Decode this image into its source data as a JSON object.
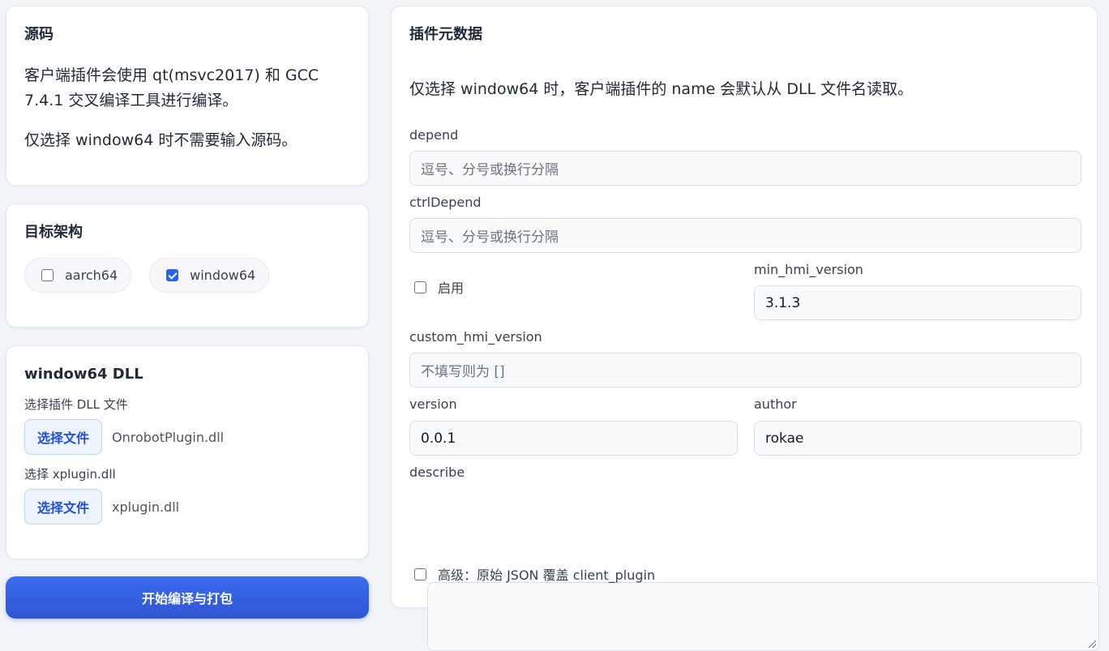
{
  "source": {
    "title": "源码",
    "line1": "客户端插件会使用 qt(msvc2017) 和 GCC 7.4.1 交叉编译工具进行编译。",
    "line2": "仅选择 window64 时不需要输入源码。"
  },
  "arch": {
    "title": "目标架构",
    "options": [
      {
        "label": "aarch64",
        "checked": false
      },
      {
        "label": "window64",
        "checked": true
      }
    ]
  },
  "dll": {
    "title": "window64 DLL",
    "plugin_label": "选择插件 DLL 文件",
    "plugin_button": "选择文件",
    "plugin_file": "OnrobotPlugin.dll",
    "xplugin_label": "选择 xplugin.dll",
    "xplugin_button": "选择文件",
    "xplugin_file": "xplugin.dll"
  },
  "build_button": "开始编译与打包",
  "meta": {
    "title": "插件元数据",
    "note": "仅选择 window64 时，客户端插件的 name 会默认从 DLL 文件名读取。",
    "depend_label": "depend",
    "depend_placeholder": "逗号、分号或换行分隔",
    "ctrl_depend_label": "ctrlDepend",
    "ctrl_depend_placeholder": "逗号、分号或换行分隔",
    "enable_label": "启用",
    "min_hmi_label": "min_hmi_version",
    "min_hmi_value": "3.1.3",
    "custom_hmi_label": "custom_hmi_version",
    "custom_hmi_placeholder": "不填写则为 []",
    "version_label": "version",
    "version_value": "0.0.1",
    "author_label": "author",
    "author_value": "rokae",
    "describe_label": "describe",
    "advanced_label": "高级：原始 JSON 覆盖 client_plugin"
  },
  "colors": {
    "accent": "#2563eb",
    "background": "#f1f4f9"
  }
}
